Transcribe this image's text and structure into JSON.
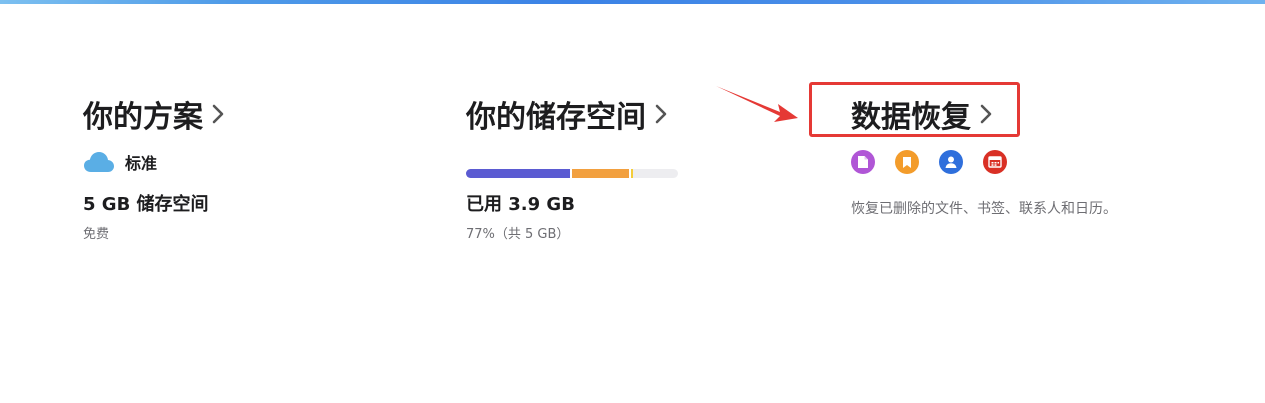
{
  "colors": {
    "accent_blue": "#3b82e6",
    "highlight_red": "#e53935",
    "storage_primary": "#5b5bd2",
    "storage_secondary": "#f2a03f",
    "storage_tertiary": "#f4cd3b",
    "icon_files": "#b056d6",
    "icon_bookmarks": "#f39c2b",
    "icon_contacts": "#2f6fdc",
    "icon_calendar": "#d93025"
  },
  "plan": {
    "title": "你的方案",
    "icon": "cloud-icon",
    "name": "标准",
    "storage": "5 GB 储存空间",
    "price": "免费"
  },
  "storage": {
    "title": "你的储存空间",
    "used": "已用 3.9 GB",
    "detail": "77%（共 5 GB）",
    "used_fraction": 0.77,
    "segments": [
      {
        "fraction": 0.49,
        "color": "#5b5bd2"
      },
      {
        "fraction": 0.27,
        "color": "#f2a03f"
      },
      {
        "fraction": 0.01,
        "color": "#f4cd3b"
      }
    ]
  },
  "recovery": {
    "title": "数据恢复",
    "icons": [
      "file-icon",
      "bookmark-icon",
      "contacts-icon",
      "calendar-icon"
    ],
    "description": "恢复已删除的文件、书签、联系人和日历。"
  }
}
